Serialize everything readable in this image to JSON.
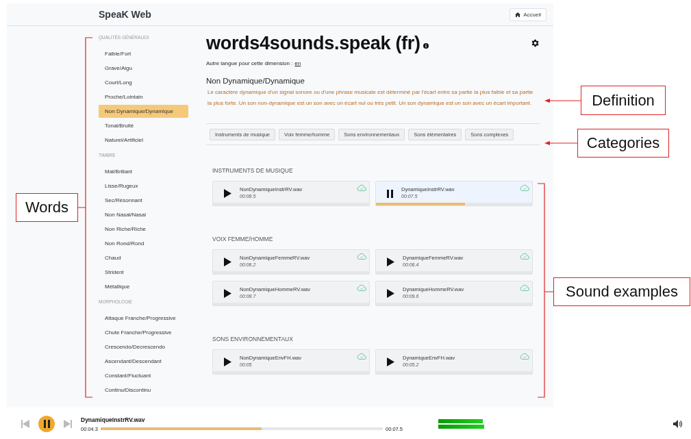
{
  "app": {
    "title": "SpeaK Web",
    "home_button": "Accueil"
  },
  "sidebar": {
    "groups": [
      {
        "heading": "QUALITÉS GÉNÉRALES",
        "items": [
          {
            "label": "Faible/Fort",
            "selected": false
          },
          {
            "label": "Grave/Aigu",
            "selected": false
          },
          {
            "label": "Court/Long",
            "selected": false
          },
          {
            "label": "Proche/Lointain",
            "selected": false
          },
          {
            "label": "Non Dynamique/Dynamique",
            "selected": true
          },
          {
            "label": "Tonal/Bruité",
            "selected": false
          },
          {
            "label": "Naturel/Artificiel",
            "selected": false
          }
        ]
      },
      {
        "heading": "TIMBRE",
        "items": [
          {
            "label": "Mat/Brillant",
            "selected": false
          },
          {
            "label": "Lisse/Rugeux",
            "selected": false
          },
          {
            "label": "Sec/Résonnant",
            "selected": false
          },
          {
            "label": "Non Nasal/Nasal",
            "selected": false
          },
          {
            "label": "Non Riche/Riche",
            "selected": false
          },
          {
            "label": "Non Rond/Rond",
            "selected": false
          },
          {
            "label": "Chaud",
            "selected": false
          },
          {
            "label": "Strident",
            "selected": false
          },
          {
            "label": "Métallique",
            "selected": false
          }
        ]
      },
      {
        "heading": "MORPHOLOGIE",
        "items": [
          {
            "label": "Attaque Franche/Progressive",
            "selected": false
          },
          {
            "label": "Chute Franche/Progressive",
            "selected": false
          },
          {
            "label": "Crescendo/Decrescendo",
            "selected": false
          },
          {
            "label": "Ascendant/Descendant",
            "selected": false
          },
          {
            "label": "Constant/Fluctuant",
            "selected": false
          },
          {
            "label": "Continu/Discontinu",
            "selected": false
          }
        ]
      }
    ]
  },
  "main": {
    "title": "words4sounds.speak (fr)",
    "other_language": {
      "label": "Autre langue pour cette dimension :",
      "link": "en"
    },
    "dimension": "Non Dynamique/Dynamique",
    "definition": "Le caractère dynamique d'un signal sonore ou d'une phrase musicale est déterminé par l'écart entre sa partie la plus faible et sa partie la plus forte. Un son non-dynamique est un son avec un écart nul ou très petit. Un son dynamique est un son avec un écart important.",
    "categories": [
      "Instruments de musique",
      "Voix femme/homme",
      "Sons environnementaux",
      "Sons élémentaires",
      "Sons complexes"
    ],
    "sections": [
      {
        "heading": "INSTRUMENTS DE MUSIQUE",
        "sounds": [
          {
            "file": "NonDynamiqueInstrRV.wav",
            "duration": "00:08.5",
            "playing": false
          },
          {
            "file": "DynamiqueInstrRV.wav",
            "duration": "00:07.5",
            "playing": true,
            "level": 0.57
          }
        ]
      },
      {
        "heading": "VOIX FEMME/HOMME",
        "sounds": [
          {
            "file": "NonDynamiqueFemmeRV.wav",
            "duration": "00:06.2",
            "playing": false
          },
          {
            "file": "DynamiqueFemmeRV.wav",
            "duration": "00:06.4",
            "playing": false
          },
          {
            "file": "NonDynamiqueHommeRV.wav",
            "duration": "00:08.7",
            "playing": false
          },
          {
            "file": "DynamiqueHommeRV.wav",
            "duration": "00:09.6",
            "playing": false
          }
        ]
      },
      {
        "heading": "SONS ENVIRONNEMENTAUX",
        "sounds": [
          {
            "file": "NonDynamiqueEnvFH.wav",
            "duration": "00:05",
            "playing": false
          },
          {
            "file": "DynamiqueEnvFH.wav",
            "duration": "00:05.2",
            "playing": false
          }
        ]
      }
    ]
  },
  "player": {
    "file": "DynamiqueInstrRV.wav",
    "elapsed": "00:04.3",
    "total": "00:07.5",
    "playing": true,
    "level": 0.57
  },
  "annotations": [
    {
      "kind": "definition",
      "label": "Definition"
    },
    {
      "kind": "categories",
      "label": "Categories"
    },
    {
      "kind": "words",
      "label": "Words"
    },
    {
      "kind": "sounds",
      "label": "Sound examples"
    }
  ]
}
